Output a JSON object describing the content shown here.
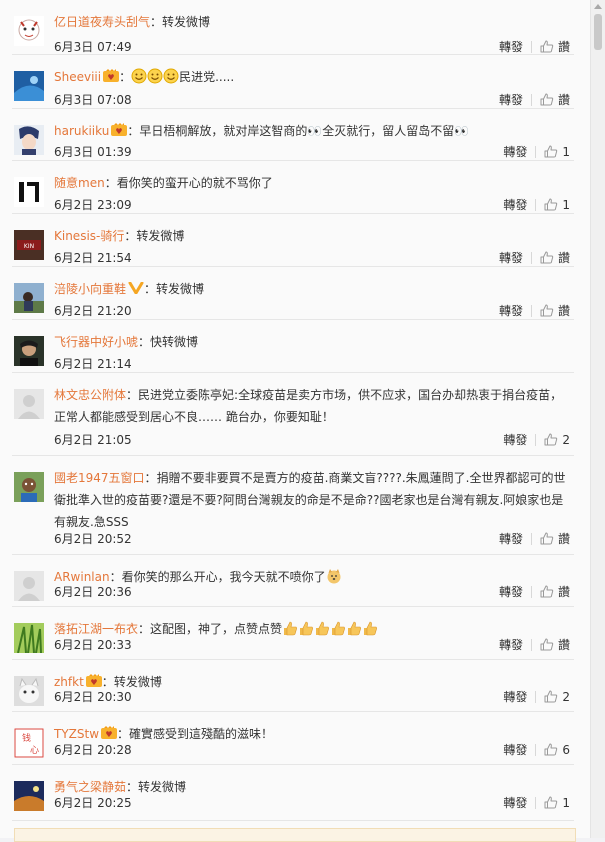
{
  "comments": [
    {
      "user": "亿日道夜寿头刮气",
      "sep": "：",
      "text": "转发微博",
      "time": "6月3日 07:49",
      "repost": "轉發",
      "like": "讚",
      "avatar_color": "#d6c6c2",
      "badge": "none",
      "emoji": "none",
      "bold_name": false
    },
    {
      "user": "Sheeviii",
      "sep": "：",
      "text": "民进党.....",
      "time": "6月3日 07:08",
      "repost": "轉發",
      "like": "讚",
      "avatar_color": "#2a6fb3",
      "badge": "vip",
      "emoji": "smile-x3",
      "bold_name": false
    },
    {
      "user": "harukiiku",
      "sep": "：",
      "text": "早日梧桐解放，就对岸这智商的👀全灭就行，留人留岛不留👀",
      "time": "6月3日 01:39",
      "repost": "轉發",
      "like": "1",
      "avatar_color": "#3c4a78",
      "badge": "vip",
      "emoji": "none",
      "bold_name": false
    },
    {
      "user": "随意men",
      "sep": "：",
      "text": "看你笑的蛮开心的就不骂你了",
      "time": "6月2日 23:09",
      "repost": "轉發",
      "like": "1",
      "avatar_color": "#222222",
      "badge": "none",
      "emoji": "none",
      "bold_name": false
    },
    {
      "user": "Kinesis-骑行",
      "sep": "：",
      "text": "转发微博",
      "time": "6月2日 21:54",
      "repost": "轉發",
      "like": "讚",
      "avatar_color": "#5a3a2a",
      "badge": "none",
      "emoji": "none",
      "bold_name": false
    },
    {
      "user": "涪陵小向重鞋",
      "sep": "：",
      "text": "转发微博",
      "time": "6月2日 21:20",
      "repost": "轉發",
      "like": "讚",
      "avatar_color": "#6f8a5b",
      "badge": "v",
      "emoji": "none",
      "bold_name": false
    },
    {
      "user": "飞行器中好小唬",
      "sep": "：",
      "text": "快转微博",
      "time": "6月2日 21:14",
      "repost": "",
      "like": "",
      "avatar_color": "#3d4a3a",
      "badge": "none",
      "emoji": "none",
      "bold_name": false
    },
    {
      "user": "林文忠公附体",
      "sep": "：",
      "text": "民进党立委陈亭妃:全球疫苗是卖方市场，供不应求，国台办却热衷于捐台疫苗，正常人都能感受到居心不良…… 跪台办，你要知耻！",
      "time": "6月2日 21:05",
      "repost": "轉發",
      "like": "2",
      "avatar_color": "#e4e4e4",
      "badge": "none",
      "emoji": "none",
      "bold_name": false
    },
    {
      "user": "國老1947五窗口",
      "sep": "：",
      "text": "捐贈不要非要買不是賣方的疫苗.商業文盲????.朱鳳蓮問了.全世界都認可的世衛批準入世的疫苗要?還是不要?阿問台灣親友的命是不是命??國老家也是台灣有親友.阿娘家也是有親友.急SSS",
      "time": "6月2日 20:52",
      "repost": "轉發",
      "like": "讚",
      "avatar_color": "#4f7a3a",
      "badge": "none",
      "emoji": "none",
      "bold_name": false
    },
    {
      "user": "ARwinlan",
      "sep": "：",
      "text": "看你笑的那么开心，我今天就不喷你了",
      "time": "6月2日 20:36",
      "repost": "轉發",
      "like": "讚",
      "avatar_color": "#e4e4e4",
      "badge": "none",
      "emoji": "dog",
      "bold_name": false
    },
    {
      "user": "落拓江湖一布衣",
      "sep": "：",
      "text": "这配图，神了，点赞点赞",
      "time": "6月2日 20:33",
      "repost": "轉發",
      "like": "讚",
      "avatar_color": "#7fae3e",
      "badge": "none",
      "emoji": "thumbs-x6",
      "bold_name": false
    },
    {
      "user": "zhfkt",
      "sep": "：",
      "text": "转发微博",
      "time": "6月2日 20:30",
      "repost": "轉發",
      "like": "2",
      "avatar_color": "#cfcfcf",
      "badge": "vip",
      "emoji": "none",
      "bold_name": false
    },
    {
      "user": "TYZStw",
      "sep": "：",
      "text": "確實感受到這殘酷的滋味！",
      "time": "6月2日 20:28",
      "repost": "轉發",
      "like": "6",
      "avatar_color": "#d9473f",
      "badge": "vip",
      "emoji": "none",
      "bold_name": false
    },
    {
      "user": "勇气之梁静茹",
      "sep": "：",
      "text": "转发微博",
      "time": "6月2日 20:25",
      "repost": "轉發",
      "like": "1",
      "avatar_color": "#2d3f7a",
      "badge": "none",
      "emoji": "none",
      "bold_name": false
    }
  ]
}
